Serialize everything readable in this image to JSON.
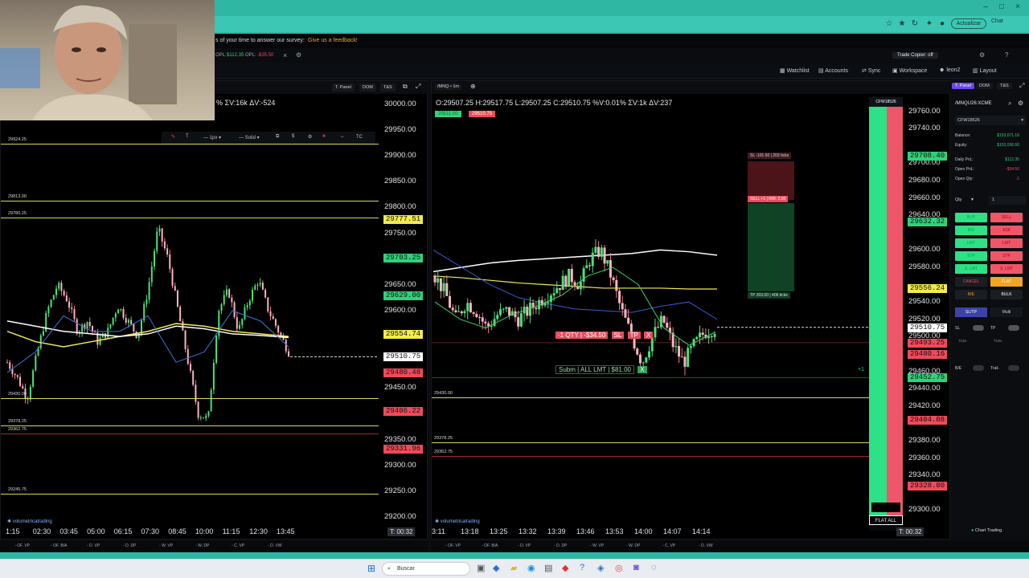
{
  "browser": {
    "update_label": "Actualizar",
    "chat_label": "Chat"
  },
  "survey": {
    "text": "s of your time to answer our survey:",
    "link": "Give us a feedback!"
  },
  "topnav": {
    "opl_label": "OPL:",
    "opl_value": "$112.35",
    "opl2_label": "OPL:",
    "opl2_value": "-$35.50",
    "trade_copier": "Trade Copier: off"
  },
  "secnav": {
    "watchlist": "Watchlist",
    "accounts": "Accounts",
    "sync": "Sync",
    "workspace": "Workspace",
    "user": "leon2",
    "layout": "Layout"
  },
  "left_chart": {
    "tabs": [
      "T. Panel",
      "DOM",
      "T&S"
    ],
    "header": "% ΣV:16k ΔV:-524",
    "draw_toolbar": {
      "stroke": "1px",
      "style": "Solid",
      "tc": "TC"
    },
    "axis": [
      "30000.00",
      "29950.00",
      "29900.00",
      "29850.00",
      "29800.00",
      "29750.00",
      "29650.00",
      "29600.00",
      "29450.00",
      "29350.00",
      "29300.00",
      "29250.00",
      "29200.00"
    ],
    "price_tags": [
      {
        "v": "29777.51",
        "c": "#f2eb4a"
      },
      {
        "v": "29703.25",
        "c": "#2fd27a"
      },
      {
        "v": "29629.00",
        "c": "#2fd27a"
      },
      {
        "v": "29554.74",
        "c": "#f2eb4a"
      },
      {
        "v": "29510.75",
        "c": "#ffffff"
      },
      {
        "v": "29480.48",
        "c": "#f04a5a"
      },
      {
        "v": "29406.22",
        "c": "#f04a5a"
      },
      {
        "v": "29331.96",
        "c": "#f04a5a"
      }
    ],
    "levels": [
      "29924.25",
      "29813.00",
      "29780.25",
      "29430.00",
      "29378.25",
      "29362.75",
      "29245.75"
    ],
    "times": [
      "1:15",
      "02:30",
      "03:45",
      "05:00",
      "06:15",
      "07:30",
      "08:45",
      "10:00",
      "11:15",
      "12:30",
      "13:45"
    ],
    "timer": "T: 00:32",
    "brand": "volumetricatrading",
    "bottom": [
      "OF. VP",
      "OF. B/A",
      "D. VP",
      "D. DP",
      "W. VP",
      "W. DP",
      "C. VP",
      "D. VW"
    ]
  },
  "right_chart": {
    "symbol": "/MNQ",
    "timeframe": "1m",
    "ohlc": "O:29507.25  H:29517.75  L:29507.25  C:29510.75  %V:0.01%  ΣV:1k  ΔV:237",
    "bid": "29511.00",
    "ask": "29510.75",
    "sl_label": "SL -101.50 | 203 ticks",
    "sell_label": "SELL +1 | R/R: 2.00",
    "tp_label": "TP 203.00 | 406 ticks",
    "position": {
      "qty": "-1 QTY | -$34.50",
      "sl": "SL",
      "tp": "TP",
      "x": "X"
    },
    "pending": {
      "label": "Subm | ALL LMT | $81.00",
      "x": "X",
      "count": "+1"
    },
    "levels": [
      "29430.00",
      "29378.25",
      "29362.75"
    ],
    "axis": [
      "29760.00",
      "29740.00",
      "29700.00",
      "29680.00",
      "29660.00",
      "29640.00",
      "29600.00",
      "29580.00",
      "29540.00",
      "29520.00",
      "29500.00",
      "29460.00",
      "29440.00",
      "29420.00",
      "29380.00",
      "29360.00",
      "29340.00",
      "29300.00"
    ],
    "price_tags": [
      {
        "v": "29708.40",
        "c": "#2fd27a"
      },
      {
        "v": "29632.32",
        "c": "#2fd27a"
      },
      {
        "v": "29556.24",
        "c": "#f2eb4a"
      },
      {
        "v": "29510.75",
        "c": "#ffffff"
      },
      {
        "v": "29493.25",
        "c": "#f04a5a"
      },
      {
        "v": "29480.16",
        "c": "#f04a5a"
      },
      {
        "v": "29452.75",
        "c": "#2fd27a"
      },
      {
        "v": "29404.08",
        "c": "#f04a5a"
      },
      {
        "v": "29328.00",
        "c": "#f04a5a"
      }
    ],
    "times": [
      "3:11",
      "13:18",
      "13:25",
      "13:32",
      "13:39",
      "13:46",
      "13:53",
      "14:00",
      "14:07",
      "14:14"
    ],
    "timer": "T: 00:32",
    "brand": "volumetricatrading",
    "account": "CFW18526",
    "flat_all": "FLAT ALL",
    "bottom": [
      "OF. VP",
      "OF. B/A",
      "D. VP",
      "D. DP",
      "W. VP",
      "W. DP",
      "C. VP",
      "D. VW"
    ]
  },
  "panel": {
    "tabs": [
      "T. Panel",
      "DOM",
      "T&S"
    ],
    "symbol": "/MNQU26:XCME",
    "account": "CFW18526",
    "rows": [
      [
        "Balance:",
        "$153,071.16"
      ],
      [
        "Equity:",
        "$153,036.66"
      ],
      [
        "Daily PnL:",
        "$112.35"
      ],
      [
        "Open PnL:",
        "-$34.50"
      ],
      [
        "Open Qty:",
        "-1"
      ]
    ],
    "qty_label": "Qty",
    "qty_value": "1",
    "buttons": [
      [
        "BUY",
        "SELL"
      ],
      [
        "BID",
        "ASK"
      ],
      [
        "LMT",
        "LMT"
      ],
      [
        "STP",
        "STP"
      ],
      [
        "S. LMT",
        "S. LMT"
      ],
      [
        "CANCEL",
        "FLAT"
      ],
      [
        "B/E",
        "BULK"
      ]
    ],
    "sltp": "SL/TP",
    "multi": "Multi",
    "sl": "SL",
    "tp": "TP",
    "ticks": "Ticks",
    "be": "B/E",
    "trail": "Trail.",
    "chart_trading": "Chart Trading"
  },
  "taskbar": {
    "search": "Buscar"
  }
}
